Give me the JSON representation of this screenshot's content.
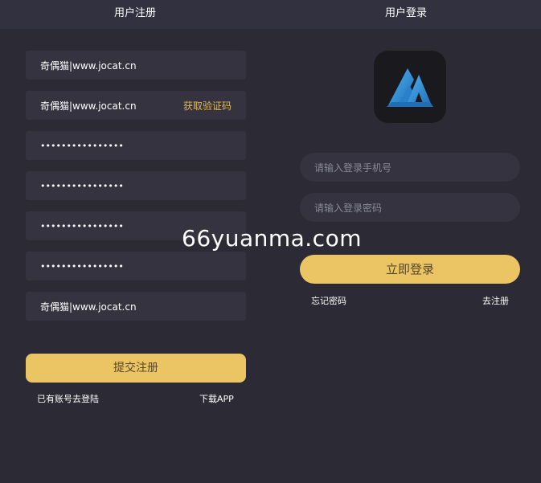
{
  "register": {
    "title": "用户注册",
    "fields": [
      {
        "value": "奇偶猫|www.jocat.cn"
      },
      {
        "value": "奇偶猫|www.jocat.cn",
        "action": "获取验证码"
      },
      {
        "value": "••••••••••••••••"
      },
      {
        "value": "••••••••••••••••"
      },
      {
        "value": "••••••••••••••••"
      },
      {
        "value": "••••••••••••••••"
      },
      {
        "value": "奇偶猫|www.jocat.cn"
      }
    ],
    "submit_label": "提交注册",
    "have_account_link": "已有账号去登陆",
    "download_link": "下载APP"
  },
  "login": {
    "title": "用户登录",
    "phone_placeholder": "请输入登录手机号",
    "password_placeholder": "请输入登录密码",
    "login_label": "立即登录",
    "forgot_link": "忘记密码",
    "register_link": "去注册"
  },
  "watermark": "66yuanma.com",
  "colors": {
    "background": "#2b2a35",
    "field": "#34333f",
    "accent": "#ebc563",
    "code_link": "#e4b84f",
    "logo_blue": "#2f8fd8"
  }
}
